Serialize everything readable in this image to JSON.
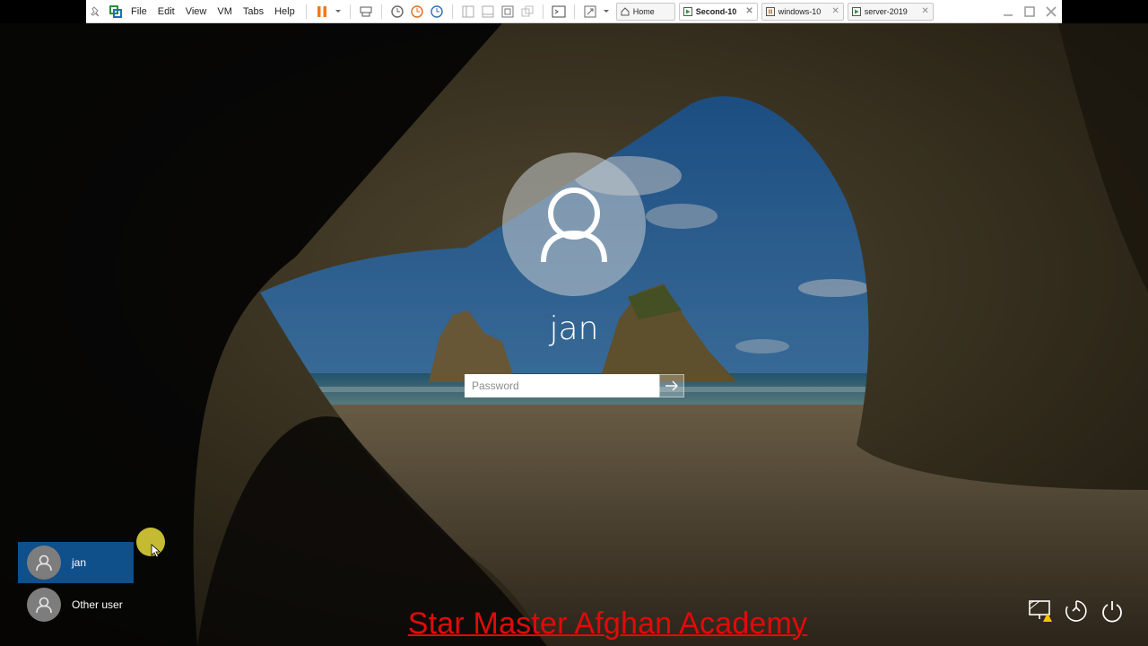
{
  "vmware": {
    "menu": [
      "File",
      "Edit",
      "View",
      "VM",
      "Tabs",
      "Help"
    ],
    "tabs": [
      {
        "label": "Home",
        "active": false
      },
      {
        "label": "Second-10",
        "active": true
      },
      {
        "label": "windows-10",
        "active": false
      },
      {
        "label": "server-2019",
        "active": false
      }
    ]
  },
  "login": {
    "username": "jan",
    "password_placeholder": "Password"
  },
  "users": [
    {
      "name": "jan",
      "selected": true
    },
    {
      "name": "Other user",
      "selected": false
    }
  ],
  "watermark": "Star Master Afghan Academy",
  "colors": {
    "selected_user_bg": "#0f4f8a",
    "watermark": "#e20a0a"
  }
}
